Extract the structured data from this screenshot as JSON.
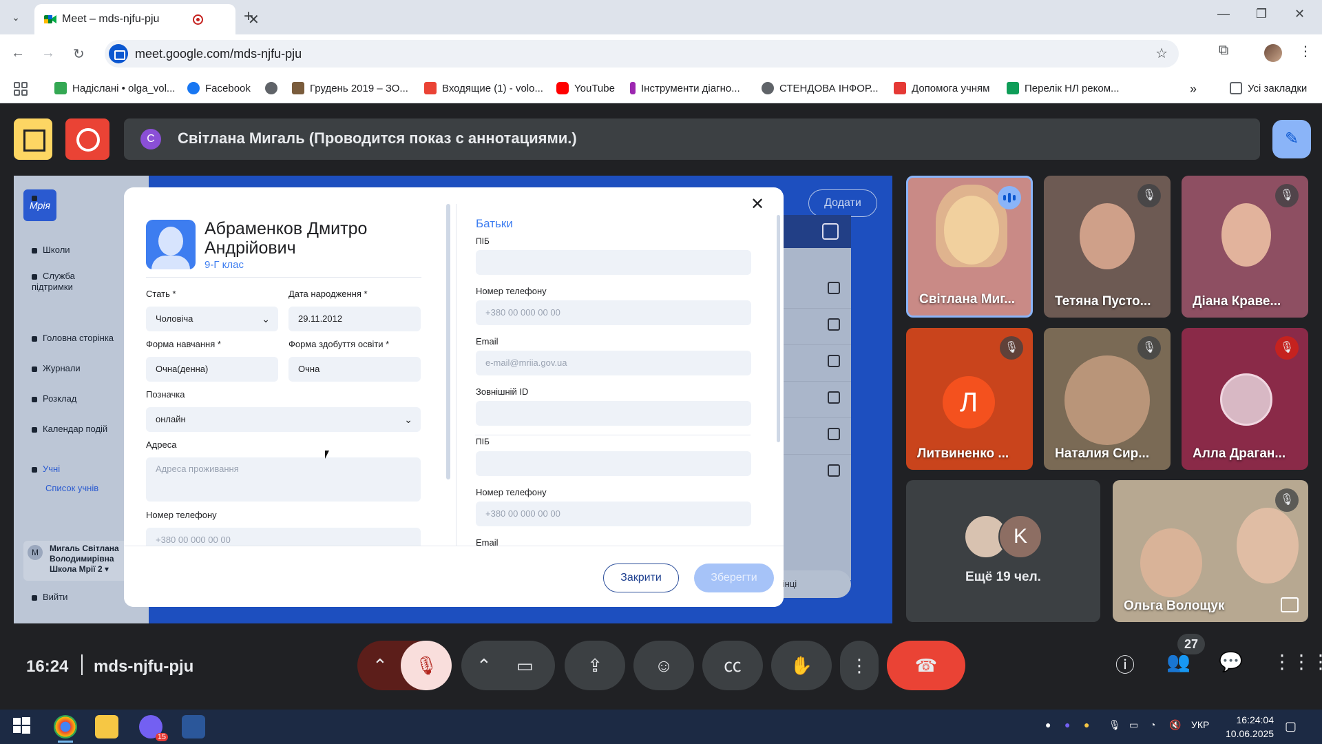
{
  "browser": {
    "tab_title": "Meet – mds-njfu-pju",
    "url": "meet.google.com/mds-njfu-pju",
    "bookmarks": [
      {
        "label": "Надіслані • olga_vol...",
        "icon": "mail-icon",
        "color": "#34a853"
      },
      {
        "label": "Facebook",
        "icon": "facebook-icon",
        "color": "#1877f2"
      },
      {
        "label": "",
        "icon": "globe-icon",
        "color": "#5f6368"
      },
      {
        "label": "Грудень 2019 – ЗО...",
        "icon": "image-icon",
        "color": "#7a5c3c"
      },
      {
        "label": "Входящие (1) - volo...",
        "icon": "gmail-icon",
        "color": "#ea4335"
      },
      {
        "label": "YouTube",
        "icon": "youtube-icon",
        "color": "#ff0000"
      },
      {
        "label": "Інструменти діагно...",
        "icon": "tool-icon",
        "color": "#9c27b0"
      },
      {
        "label": "СТЕНДОВА ІНФОР...",
        "icon": "globe-icon",
        "color": "#5f6368"
      },
      {
        "label": "Допомога учням",
        "icon": "book-icon",
        "color": "#e53935"
      },
      {
        "label": "Перелік НЛ реком...",
        "icon": "sheets-icon",
        "color": "#0f9d58"
      }
    ],
    "all_bookmarks": "Усі закладки"
  },
  "meet": {
    "presenter_initial": "С",
    "presenter_text": "Світлана Мигаль (Проводится показ с аннотациями.)",
    "time": "16:24",
    "meeting_code": "mds-njfu-pju",
    "participants_count": "27",
    "more_label": "Ещё 19 чел.",
    "more_initial": "K",
    "participants": [
      {
        "name": "Світлана Миг...",
        "status": "speaking"
      },
      {
        "name": "Тетяна Пусто...",
        "status": "muted"
      },
      {
        "name": "Діана Краве...",
        "status": "muted"
      },
      {
        "name": "Литвиненко ...",
        "status": "muted",
        "initial": "Л"
      },
      {
        "name": "Наталия Сир...",
        "status": "muted"
      },
      {
        "name": "Алла Драган...",
        "status": "muted-red"
      },
      {
        "name": "Ольга Волощук",
        "status": "muted"
      }
    ]
  },
  "app": {
    "logo": "Мрія",
    "add_button": "Додати",
    "pager_label": "сторінці",
    "sidebar": [
      {
        "label": "Школи"
      },
      {
        "label": "Служба підтримки"
      },
      {
        "label": "Головна сторінка"
      },
      {
        "label": "Журнали"
      },
      {
        "label": "Розклад"
      },
      {
        "label": "Календар подій"
      },
      {
        "label": "Учні"
      }
    ],
    "sidebar_sub": "Список учнів",
    "user_initial": "М",
    "user_name": "Мигаль Світлана Володимирівна Школа Мрії 2 ▾",
    "logout": "Вийти"
  },
  "modal": {
    "student_name": "Абраменков Дмитро Андрійович",
    "student_class": "9-Г клас",
    "fields": {
      "gender_label": "Стать *",
      "gender_value": "Чоловіча",
      "birth_label": "Дата народження *",
      "birth_value": "29.11.2012",
      "study_form_label": "Форма навчання *",
      "study_form_value": "Очна(денна)",
      "edu_form_label": "Форма здобуття освіти *",
      "edu_form_value": "Очна",
      "mark_label": "Позначка",
      "mark_value": "онлайн",
      "address_label": "Адреса",
      "address_placeholder": "Адреса проживання",
      "phone_label": "Номер телефону",
      "phone_placeholder": "+380 00 000 00 00"
    },
    "parents": {
      "title": "Батьки",
      "pib_label": "ПІБ",
      "phone_label": "Номер телефону",
      "phone_placeholder": "+380 00 000 00 00",
      "email_label": "Email",
      "email_placeholder": "e-mail@mriia.gov.ua",
      "external_id_label": "Зовнішній ID",
      "pib2_label": "ПІБ",
      "phone2_label": "Номер телефону",
      "phone2_placeholder": "+380 00 000 00 00",
      "email2_label": "Email"
    },
    "close_button": "Закрити",
    "save_button": "Зберегти"
  },
  "taskbar": {
    "lang": "УКР",
    "time": "16:24:04",
    "date": "10.06.2025",
    "viber_badge": "15"
  }
}
